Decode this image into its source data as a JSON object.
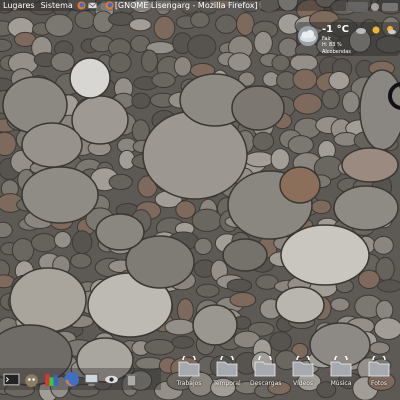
{
  "top_panel": {
    "menus": [
      "Lugares",
      "Sistema"
    ],
    "window_button": "[GNOME Lisengarg - Mozilla Firefox]"
  },
  "weather": {
    "temperature": "-1 °C",
    "condition": "Fair",
    "humidity": "H: 83 %",
    "city": "Alcobendas"
  },
  "dock": {
    "launchers": [
      "terminal-icon",
      "gimp-icon",
      "system-monitor-icon",
      "firefox-icon",
      "computer-icon",
      "eye-icon",
      "trash-icon"
    ]
  },
  "desktop_folders": [
    {
      "label": "Trabajos"
    },
    {
      "label": "Temporal"
    },
    {
      "label": "Descargas"
    },
    {
      "label": "Vídeos"
    },
    {
      "label": "Música"
    },
    {
      "label": "Fotos"
    }
  ]
}
